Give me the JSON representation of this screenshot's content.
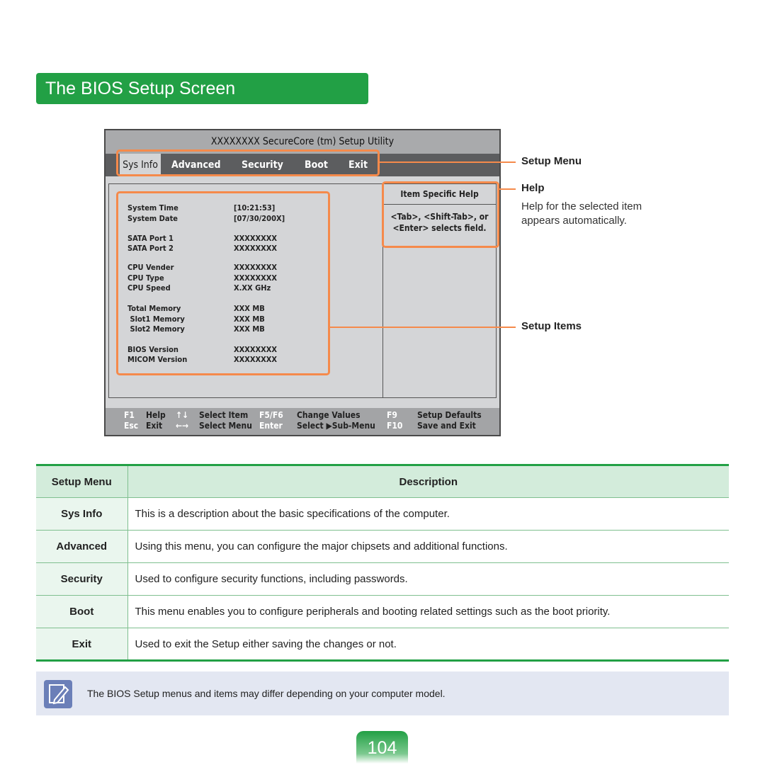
{
  "title": "The BIOS Setup Screen",
  "bios": {
    "title": "XXXXXXXX SecureCore (tm) Setup Utility",
    "menu": [
      "Sys Info",
      "Advanced",
      "Security",
      "Boot",
      "Exit"
    ],
    "help_header": "Item Specific Help",
    "help_text": "<Tab>, <Shift-Tab>, or <Enter> selects field.",
    "items": [
      {
        "label": "System Time",
        "value": "[10:21:53]"
      },
      {
        "label": "System Date",
        "value": "[07/30/200X]"
      },
      {
        "label": "SATA Port 1",
        "value": "XXXXXXXX"
      },
      {
        "label": "SATA Port 2",
        "value": "XXXXXXXX"
      },
      {
        "label": "CPU Vender",
        "value": "XXXXXXXX"
      },
      {
        "label": "CPU Type",
        "value": "XXXXXXXX"
      },
      {
        "label": "CPU Speed",
        "value": "X.XX GHz"
      },
      {
        "label": "Total Memory",
        "value": "XXX MB"
      },
      {
        "label": " Slot1 Memory",
        "value": "XXX MB"
      },
      {
        "label": " Slot2 Memory",
        "value": "XXX MB"
      },
      {
        "label": "BIOS Version",
        "value": "XXXXXXXX"
      },
      {
        "label": "MICOM Version",
        "value": "XXXXXXXX"
      }
    ],
    "footer": [
      {
        "key": "F1",
        "desc": "Help"
      },
      {
        "key": "↑↓",
        "desc": "Select Item"
      },
      {
        "key": "F5/F6",
        "desc": "Change Values"
      },
      {
        "key": "F9",
        "desc": "Setup Defaults"
      },
      {
        "key": "Esc",
        "desc": "Exit"
      },
      {
        "key": "←→",
        "desc": "Select Menu"
      },
      {
        "key": "Enter",
        "desc": "Select ▶Sub-Menu"
      },
      {
        "key": "F10",
        "desc": "Save and Exit"
      }
    ]
  },
  "callouts": {
    "setup_menu": "Setup Menu",
    "help": "Help",
    "help_desc_1": "Help for the selected item",
    "help_desc_2": "appears automatically.",
    "setup_items": "Setup Items"
  },
  "table": {
    "headers": [
      "Setup Menu",
      "Description"
    ],
    "rows": [
      {
        "menu": "Sys Info",
        "desc": "This is a description about the basic specifications of the computer."
      },
      {
        "menu": "Advanced",
        "desc": "Using this menu, you can configure the major chipsets and additional functions."
      },
      {
        "menu": "Security",
        "desc": "Used to configure security functions, including passwords."
      },
      {
        "menu": "Boot",
        "desc": "This menu enables you to configure peripherals and booting related settings such as the boot priority."
      },
      {
        "menu": "Exit",
        "desc": "Used to exit the Setup either saving the changes or not."
      }
    ]
  },
  "note": {
    "icon": "pencil-note-icon",
    "text": "The BIOS Setup menus and items may differ depending on your computer model."
  },
  "page_number": "104"
}
